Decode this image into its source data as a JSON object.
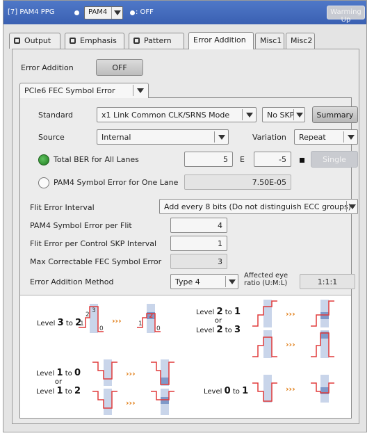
{
  "title_bar": {
    "channel_label": "[7] PAM4 PPG",
    "mode_value": "PAM4",
    "output_status": ": OFF",
    "warming_up_label": "Warming Up"
  },
  "tabs": [
    {
      "label": "Output",
      "icon": "output-icon"
    },
    {
      "label": "Emphasis",
      "icon": "emphasis-icon"
    },
    {
      "label": "Pattern",
      "icon": "pattern-icon"
    },
    {
      "label": "Error Addition",
      "active": true
    },
    {
      "label": "Misc1"
    },
    {
      "label": "Misc2"
    }
  ],
  "error_addition": {
    "label": "Error Addition",
    "toggle_value": "OFF"
  },
  "error_type": {
    "value": "PCIe6 FEC Symbol Error"
  },
  "form": {
    "standard": {
      "label": "Standard",
      "value": "x1 Link Common CLK/SRNS Mode",
      "skp_value": "No SKP",
      "summary_label": "Summary"
    },
    "source": {
      "label": "Source",
      "value": "Internal",
      "variation_label": "Variation",
      "variation_value": "Repeat"
    },
    "total_ber": {
      "label": "Total BER for All Lanes",
      "mantissa": "5",
      "e_label": "E",
      "exponent": "-5",
      "single_label": "Single",
      "selected": true
    },
    "pam4_symbol": {
      "label": "PAM4 Symbol Error for One Lane",
      "value": "7.50E-05",
      "selected": false
    },
    "flit_interval": {
      "label": "Flit Error Interval",
      "value": "Add every 8 bits (Do not distinguish ECC groups)"
    },
    "pam4_per_flit": {
      "label": "PAM4 Symbol Error per Flit",
      "value": "4"
    },
    "flit_per_skp": {
      "label": "Flit Error per Control SKP Interval",
      "value": "1"
    },
    "max_fec": {
      "label": "Max Correctable FEC Symbol Error",
      "value": "3"
    },
    "method": {
      "label": "Error Addition Method",
      "value": "Type 4",
      "eye_label_1": "Affected eye",
      "eye_label_2": "ratio (U:M:L)",
      "eye_value": "1:1:1"
    }
  },
  "diagram": {
    "level_word": "Level",
    "to_word": "to",
    "or_word": "or",
    "l32": {
      "from": "3",
      "to": "2"
    },
    "l21": {
      "from": "2",
      "to": "1"
    },
    "l23": {
      "from": "2",
      "to": "3"
    },
    "l10": {
      "from": "1",
      "to": "0"
    },
    "l12": {
      "from": "1",
      "to": "2"
    },
    "l01": {
      "from": "0",
      "to": "1"
    },
    "symbols": {
      "s0": "0",
      "s1": "1",
      "s2": "2",
      "s3": "3"
    },
    "arrow": "›››",
    "colors": {
      "signal": "#e03a3a",
      "column": "#c9d5ea",
      "highlight": "#7f99c9",
      "arrow": "#e07a10"
    }
  }
}
